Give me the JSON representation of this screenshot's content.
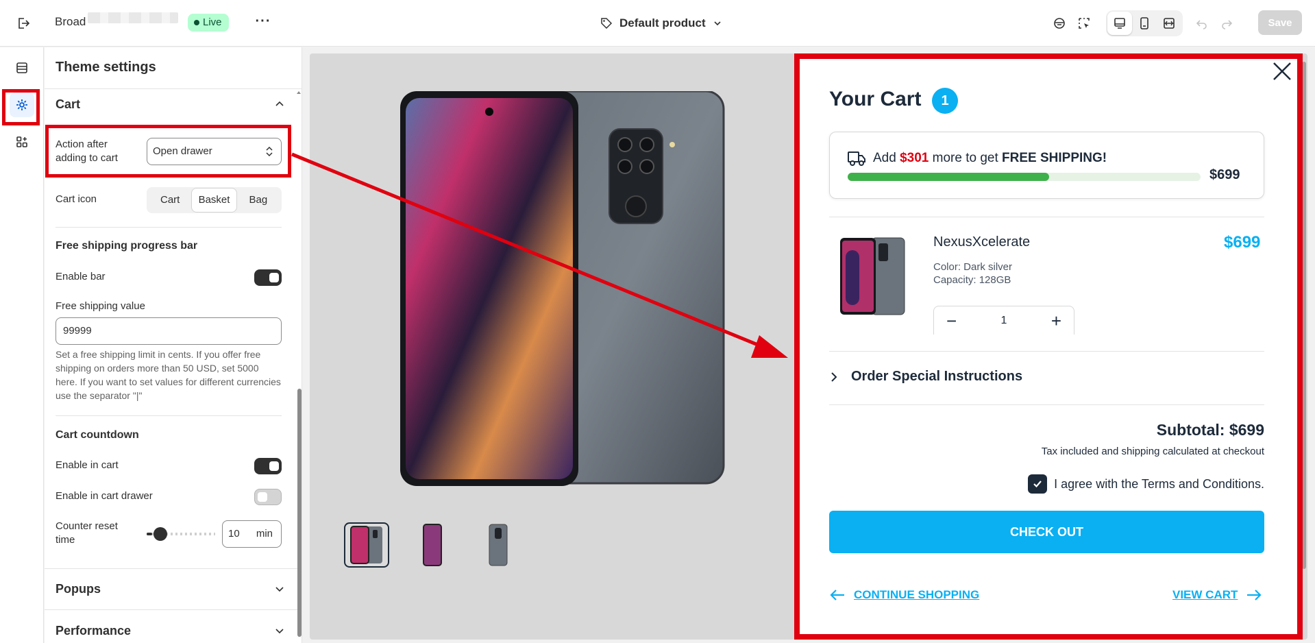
{
  "topbar": {
    "store_name": "Broad",
    "live_label": "Live",
    "template_label": "Default product",
    "save_label": "Save"
  },
  "panel": {
    "title": "Theme settings",
    "cart": {
      "heading": "Cart",
      "action_label": "Action after adding to cart",
      "action_value": "Open drawer",
      "icon_label": "Cart icon",
      "icon_options": [
        "Cart",
        "Basket",
        "Bag"
      ],
      "icon_selected": "Basket"
    },
    "free_shipping": {
      "heading": "Free shipping progress bar",
      "enable_label": "Enable bar",
      "enable_value": true,
      "value_label": "Free shipping value",
      "value": "99999",
      "help": "Set a free shipping limit in cents. If you offer free shipping on orders more than 50 USD, set 5000 here. If you want to set values for different currencies use the separator \"|\""
    },
    "countdown": {
      "heading": "Cart countdown",
      "enable_cart_label": "Enable in cart",
      "enable_cart_value": true,
      "enable_drawer_label": "Enable in cart drawer",
      "enable_drawer_value": false,
      "reset_label": "Counter reset time",
      "reset_value": "10",
      "reset_unit": "min",
      "reset_slider_fraction": 0.08
    },
    "popups_heading": "Popups",
    "performance_heading": "Performance"
  },
  "cart_drawer": {
    "title": "Your Cart",
    "count": "1",
    "shipping": {
      "prefix": "Add",
      "amount": "$301",
      "middle": "more to get",
      "emphasis": "FREE SHIPPING!",
      "goal": "$699",
      "progress_fraction": 0.57
    },
    "item": {
      "name": "NexusXcelerate",
      "price": "$699",
      "color": "Color: Dark silver",
      "capacity": "Capacity: 128GB",
      "quantity": "1"
    },
    "instructions_label": "Order Special Instructions",
    "subtotal": "Subtotal: $699",
    "tax_note": "Tax included and shipping calculated at checkout",
    "agree_label": "I agree with the Terms and Conditions.",
    "checkout_label": "CHECK OUT",
    "continue_label": "CONTINUE SHOPPING",
    "view_cart_label": "VIEW CART"
  },
  "colors": {
    "accent": "#0ab0f2",
    "highlight": "#e0000f",
    "progress": "#3fb14a",
    "navy": "#1d2a3a"
  }
}
